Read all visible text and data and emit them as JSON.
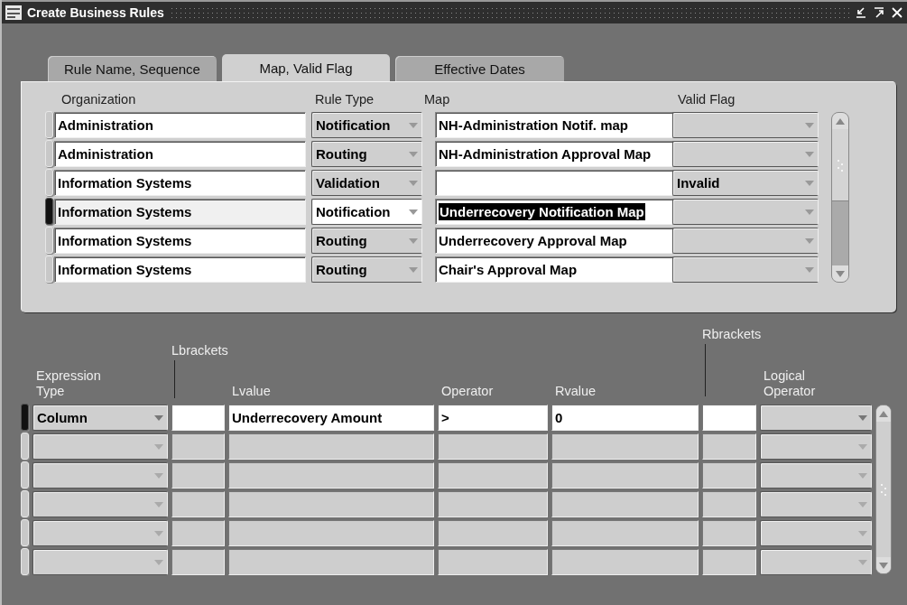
{
  "window": {
    "title": "Create Business Rules"
  },
  "tabs": [
    {
      "label": "Rule Name, Sequence",
      "selected": false
    },
    {
      "label": "Map, Valid Flag",
      "selected": true
    },
    {
      "label": "Effective Dates",
      "selected": false
    }
  ],
  "rules": {
    "columns": [
      "Organization",
      "Rule Type",
      "Map",
      "Valid Flag"
    ],
    "rows": [
      {
        "organization": "Administration",
        "rule_type": "Notification",
        "map": "NH-Administration Notif. map",
        "selected": false
      },
      {
        "organization": "Administration",
        "rule_type": "Routing",
        "map": "NH-Administration Approval Map",
        "selected": false
      },
      {
        "organization": "Information Systems",
        "rule_type": "Validation",
        "valid_flag": "Invalid",
        "selected": false
      },
      {
        "organization": "Information Systems",
        "rule_type": "Notification",
        "map": "Underrecovery Notification Map",
        "selected": true
      },
      {
        "organization": "Information Systems",
        "rule_type": "Routing",
        "map": "Underrecovery Approval Map",
        "selected": false
      },
      {
        "organization": "Information Systems",
        "rule_type": "Routing",
        "map": "Chair's Approval Map",
        "selected": false
      }
    ]
  },
  "expressions": {
    "columns": [
      {
        "label": "Expression Type",
        "kind": "plain"
      },
      {
        "label": "Lbrackets",
        "kind": "leader"
      },
      {
        "label": "Lvalue",
        "kind": "plain"
      },
      {
        "label": "Operator",
        "kind": "plain"
      },
      {
        "label": "Rvalue",
        "kind": "plain"
      },
      {
        "label": "Rbrackets",
        "kind": "leader"
      },
      {
        "label": "Logical Operator",
        "kind": "plain"
      }
    ],
    "rows": [
      {
        "selected": true,
        "expression_type": "Column",
        "lvalue": "Underrecovery Amount",
        "operator": ">",
        "rvalue": "0"
      },
      {
        "selected": false
      },
      {
        "selected": false
      },
      {
        "selected": false
      },
      {
        "selected": false
      },
      {
        "selected": false
      }
    ]
  }
}
